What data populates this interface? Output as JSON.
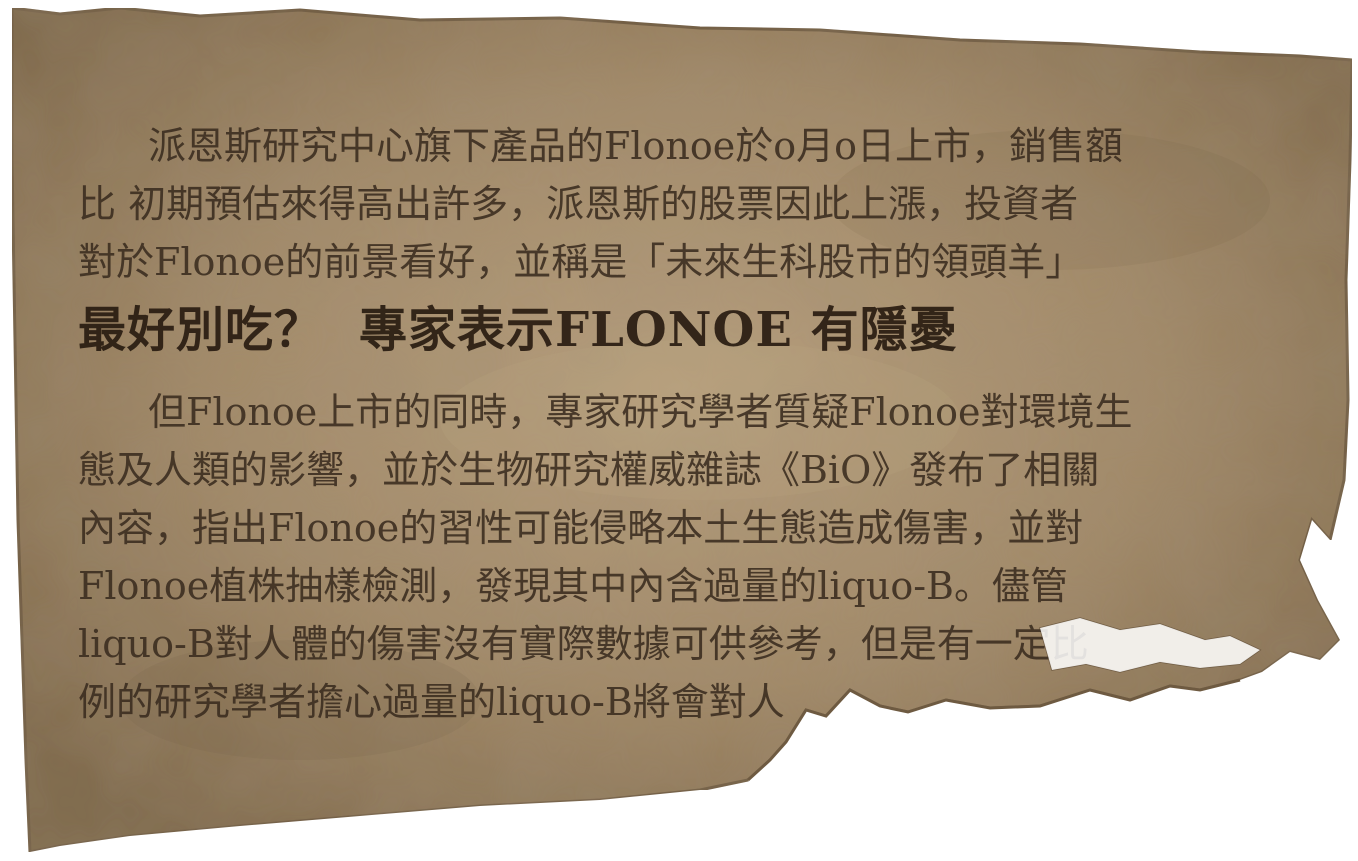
{
  "colors": {
    "paper": "#9a8262",
    "paper_light": "#b49c7b",
    "paper_edge": "#6e5a41",
    "ink": "#3a2c1f",
    "headline_ink": "#2a1d12"
  },
  "article": {
    "paragraph1": [
      "派恩斯研究中心旗下產品的Flonoe於o月o日上市，銷售額",
      "比 初期預估來得高出許多，派恩斯的股票因此上漲，投資者",
      "對於Flonoe的前景看好，並稱是「未來生科股市的領頭羊」"
    ],
    "headline_part1": "最好別吃？",
    "headline_part2": "專家表示FLONOE 有隱憂",
    "paragraph2": [
      "但Flonoe上市的同時，專家研究學者質疑Flonoe對環境生",
      "態及人類的影響，並於生物研究權威雜誌《BiO》發布了相關",
      "內容，指出Flonoe的習性可能侵略本土生態造成傷害，並對",
      "Flonoe植株抽樣檢測，發現其中內含過量的liquo-B。儘管",
      "liquo-B對人體的傷害沒有實際數據可供參考，但是有一定比",
      "例的研究學者擔心過量的liquo-B將會對人"
    ]
  }
}
